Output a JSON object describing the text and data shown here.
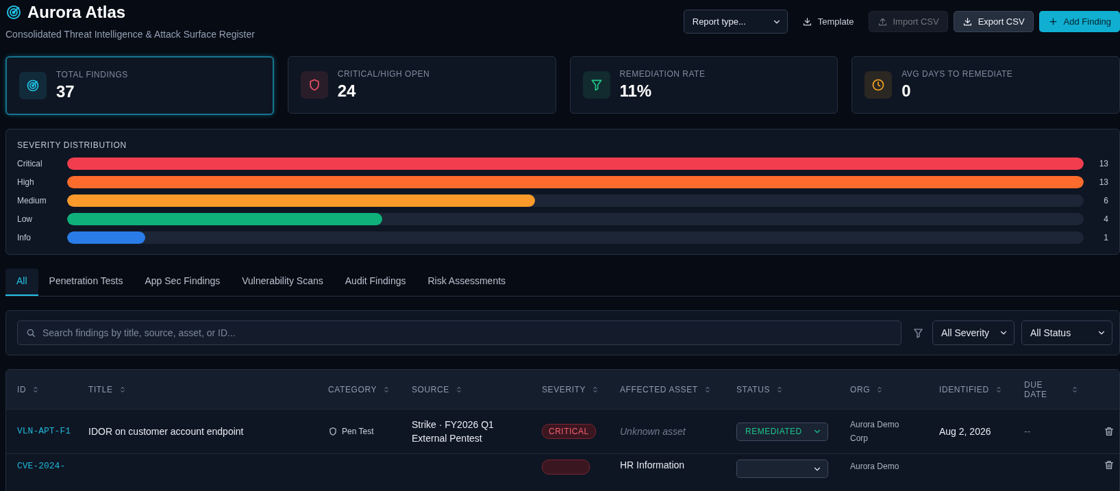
{
  "header": {
    "title": "Aurora Atlas",
    "subtitle": "Consolidated Threat Intelligence & Attack Surface Register",
    "report_select": {
      "value": "Report type..."
    },
    "buttons": [
      {
        "label": "Template",
        "kind": "ghost",
        "disabled": false
      },
      {
        "label": "Import CSV",
        "kind": "secondary",
        "disabled": true
      },
      {
        "label": "Export CSV",
        "kind": "secondary",
        "disabled": false
      },
      {
        "label": "Add Finding",
        "kind": "primary",
        "disabled": false
      }
    ]
  },
  "stats": [
    {
      "label": "TOTAL FINDINGS",
      "value": "37",
      "color": "#22c3e6",
      "selected": true
    },
    {
      "label": "CRITICAL/HIGH OPEN",
      "value": "24",
      "color": "#f05265",
      "selected": false
    },
    {
      "label": "REMEDIATION RATE",
      "value": "11%",
      "color": "#22c98a",
      "selected": false
    },
    {
      "label": "AVG DAYS TO REMEDIATE",
      "value": "0",
      "color": "#f5a524",
      "selected": false
    }
  ],
  "severity_distribution": {
    "title": "SEVERITY DISTRIBUTION",
    "rows": [
      {
        "label": "Critical",
        "count": "13",
        "level": 1,
        "color": "#f23d4f"
      },
      {
        "label": "High",
        "count": "13",
        "level": 1,
        "color": "#ff6b2c"
      },
      {
        "label": "Medium",
        "count": "6",
        "level": 0.46,
        "color": "#fb9a2b"
      },
      {
        "label": "Low",
        "count": "4",
        "level": 0.31,
        "color": "#0fb07a"
      },
      {
        "label": "Info",
        "count": "1",
        "level": 0.077,
        "color": "#2a7ce8"
      }
    ]
  },
  "tabs": [
    {
      "label": "All",
      "selected": true
    },
    {
      "label": "Penetration Tests",
      "selected": false
    },
    {
      "label": "App Sec Findings",
      "selected": false
    },
    {
      "label": "Vulnerability Scans",
      "selected": false
    },
    {
      "label": "Audit Findings",
      "selected": false
    },
    {
      "label": "Risk Assessments",
      "selected": false
    }
  ],
  "filters": {
    "search": {
      "placeholder": "Search findings by title, source, asset, or ID..."
    },
    "severity": {
      "value": "All Severity"
    },
    "status": {
      "value": "All Status"
    }
  },
  "table": {
    "columns": [
      "ID",
      "TITLE",
      "CATEGORY",
      "SOURCE",
      "SEVERITY",
      "AFFECTED ASSET",
      "STATUS",
      "ORG",
      "IDENTIFIED",
      "DUE DATE"
    ],
    "rows": [
      {
        "id": "VLN-APT-F1",
        "title": "IDOR on customer account endpoint",
        "category": "Pen Test",
        "source": "Strike · FY2026 Q1 External Pentest",
        "severity": "CRITICAL",
        "asset": "Unknown asset",
        "asset_known": false,
        "status": "REMEDIATED",
        "org": "Aurora Demo Corp",
        "identified": "Aug 2, 2026",
        "due": "--"
      },
      {
        "id": "CVE-2024-",
        "title": "",
        "category": "",
        "source": "",
        "severity": "",
        "asset": "HR Information",
        "asset_known": true,
        "status": "",
        "org": "Aurora Demo",
        "identified": "",
        "due": ""
      }
    ]
  }
}
